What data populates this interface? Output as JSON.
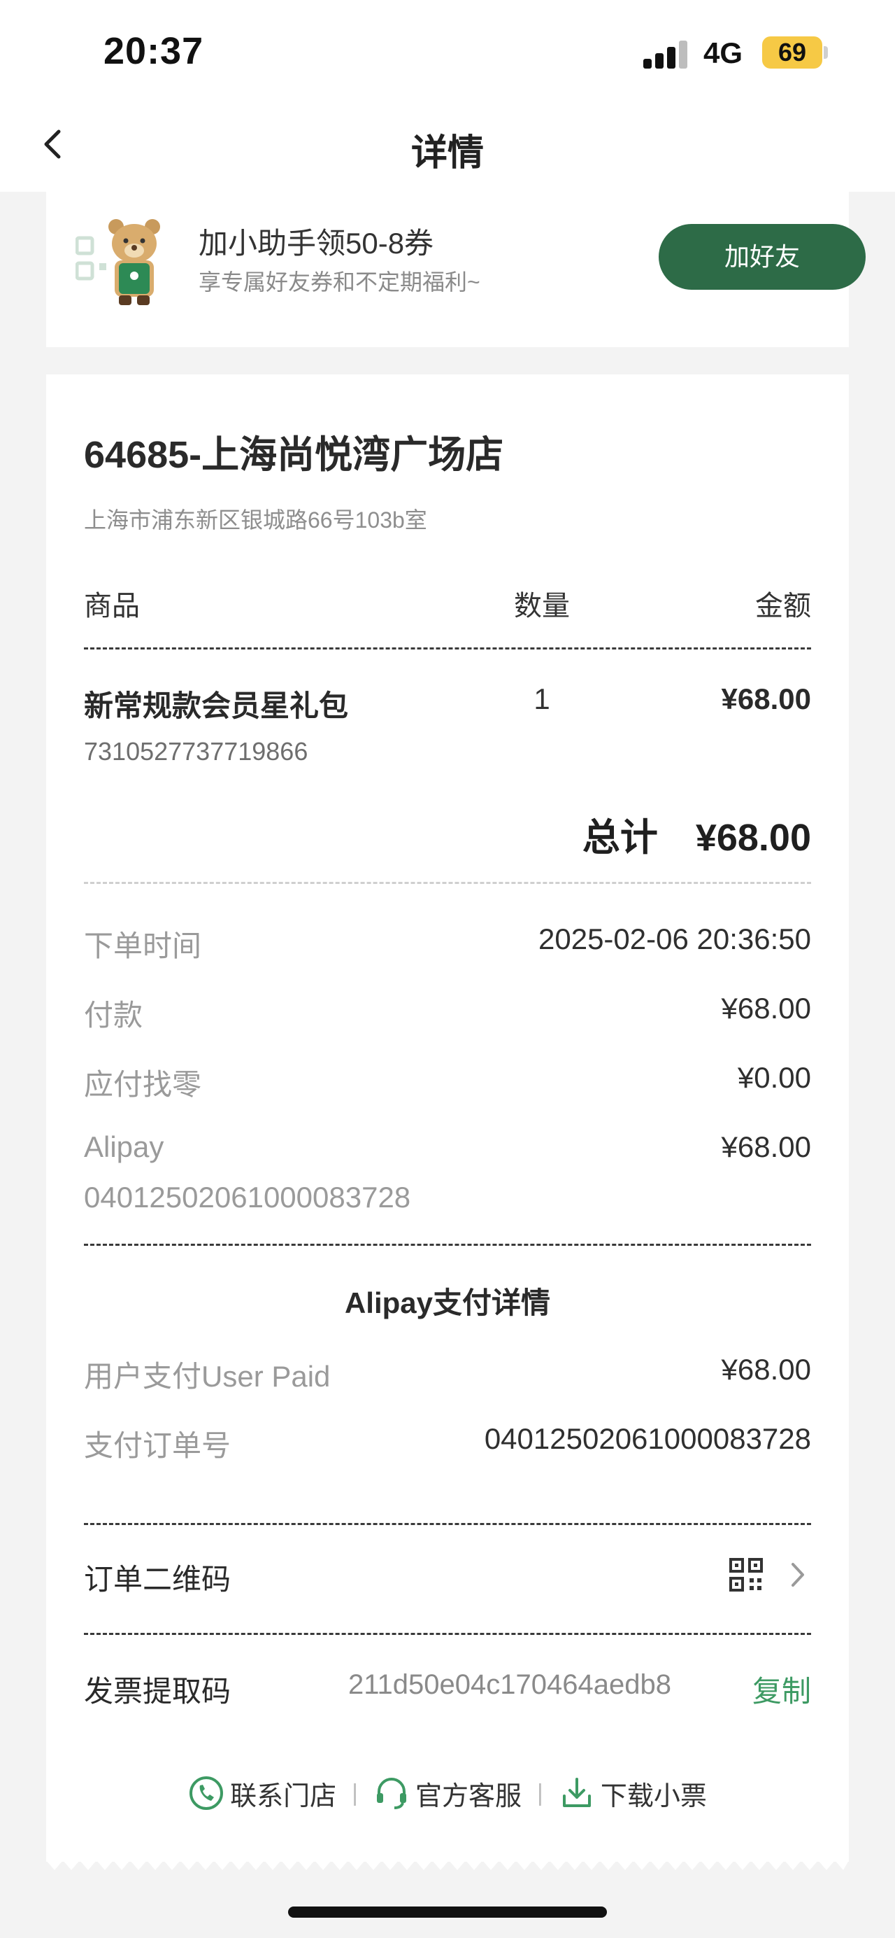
{
  "status_bar": {
    "time": "20:37",
    "network": "4G",
    "battery": "69"
  },
  "nav": {
    "title": "详情"
  },
  "promo": {
    "title": "加小助手领50-8券",
    "subtitle": "享专属好友券和不定期福利~",
    "button": "加好友"
  },
  "store": {
    "name": "64685-上海尚悦湾广场店",
    "address": "上海市浦东新区银城路66号103b室"
  },
  "table_header": {
    "product": "商品",
    "quantity": "数量",
    "amount": "金额"
  },
  "item": {
    "name": "新常规款会员星礼包",
    "quantity": "1",
    "amount": "¥68.00",
    "code": "7310527737719866"
  },
  "total": {
    "label": "总计",
    "value": "¥68.00"
  },
  "details": [
    {
      "label": "下单时间",
      "value": "2025-02-06 20:36:50"
    },
    {
      "label": "付款",
      "value": "¥68.00"
    },
    {
      "label": "应付找零",
      "value": "¥0.00"
    },
    {
      "label": "Alipay",
      "value": "¥68.00"
    }
  ],
  "alipay_ref": "0401250206100008372​8",
  "payment": {
    "title": "Alipay支付详情",
    "rows": [
      {
        "label": "用户支付User Paid",
        "value": "¥68.00"
      },
      {
        "label": "支付订单号",
        "value": "04012502061000083728"
      }
    ]
  },
  "order_qr": {
    "label": "订单二维码"
  },
  "invoice": {
    "label": "发票提取码",
    "code": "211d50e04c170464aedb8",
    "copy": "复制"
  },
  "links": {
    "contact_store": "联系门店",
    "service": "官方客服",
    "download": "下载小票"
  },
  "colors": {
    "brand_green": "#2d6b47",
    "link_green": "#3d9a63",
    "battery": "#f6c945"
  }
}
